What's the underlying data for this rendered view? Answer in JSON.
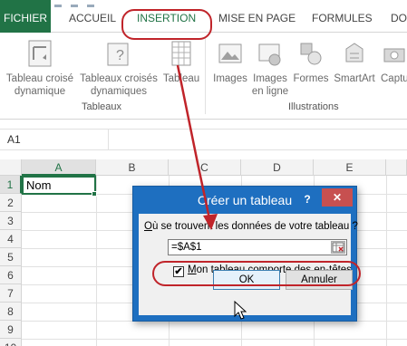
{
  "ribbon_tabs": {
    "file": "FICHIER",
    "home": "ACCUEIL",
    "insert": "INSERTION",
    "page_layout": "MISE EN PAGE",
    "formulas": "FORMULES",
    "data": "DO"
  },
  "ribbon": {
    "pivot_table": "Tableau croisé\ndynamique",
    "pivot_table_l1": "Tableau croisé",
    "pivot_table_l2": "dynamique",
    "recommended_pivot_l1": "Tableaux croisés",
    "recommended_pivot_l2": "dynamiques",
    "table": "Tableau",
    "images": "Images",
    "online_images_l1": "Images",
    "online_images_l2": "en ligne",
    "shapes": "Formes",
    "smartart": "SmartArt",
    "screenshot": "Captu",
    "group_tables": "Tableaux",
    "group_illustrations": "Illustrations"
  },
  "formula_bar": {
    "name_box": "A1"
  },
  "grid": {
    "columns": [
      "A",
      "B",
      "C",
      "D",
      "E"
    ],
    "rows": [
      "1",
      "2",
      "3",
      "4",
      "5",
      "6",
      "7",
      "8",
      "9",
      "10"
    ],
    "a1_value": "Nom"
  },
  "dialog": {
    "title": "Créer un tableau",
    "help": "?",
    "close": "✕",
    "prompt_first": "O",
    "prompt_rest": "ù se trouvent les données de votre tableau ?",
    "range_value": "=$A$1",
    "checkbox_label_first": "M",
    "checkbox_label_rest": "on tableau comporte des en-têtes",
    "checkbox_checked": true,
    "ok": "OK",
    "cancel": "Annuler"
  },
  "colors": {
    "excel_green": "#217346",
    "dialog_blue": "#1e6fc0",
    "annotation_red": "#c0242a"
  }
}
